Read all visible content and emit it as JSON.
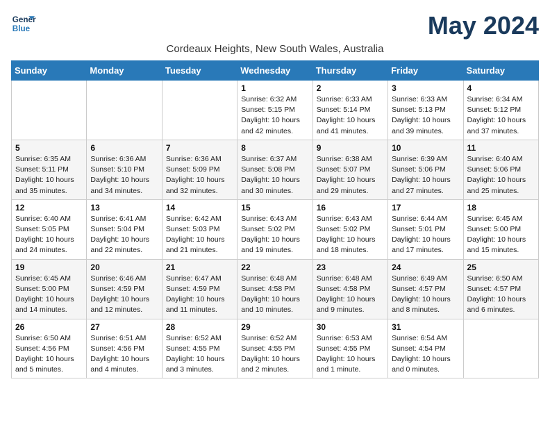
{
  "header": {
    "logo_line1": "General",
    "logo_line2": "Blue",
    "month_title": "May 2024",
    "subtitle": "Cordeaux Heights, New South Wales, Australia"
  },
  "weekdays": [
    "Sunday",
    "Monday",
    "Tuesday",
    "Wednesday",
    "Thursday",
    "Friday",
    "Saturday"
  ],
  "weeks": [
    [
      {
        "day": "",
        "info": ""
      },
      {
        "day": "",
        "info": ""
      },
      {
        "day": "",
        "info": ""
      },
      {
        "day": "1",
        "info": "Sunrise: 6:32 AM\nSunset: 5:15 PM\nDaylight: 10 hours and 42 minutes."
      },
      {
        "day": "2",
        "info": "Sunrise: 6:33 AM\nSunset: 5:14 PM\nDaylight: 10 hours and 41 minutes."
      },
      {
        "day": "3",
        "info": "Sunrise: 6:33 AM\nSunset: 5:13 PM\nDaylight: 10 hours and 39 minutes."
      },
      {
        "day": "4",
        "info": "Sunrise: 6:34 AM\nSunset: 5:12 PM\nDaylight: 10 hours and 37 minutes."
      }
    ],
    [
      {
        "day": "5",
        "info": "Sunrise: 6:35 AM\nSunset: 5:11 PM\nDaylight: 10 hours and 35 minutes."
      },
      {
        "day": "6",
        "info": "Sunrise: 6:36 AM\nSunset: 5:10 PM\nDaylight: 10 hours and 34 minutes."
      },
      {
        "day": "7",
        "info": "Sunrise: 6:36 AM\nSunset: 5:09 PM\nDaylight: 10 hours and 32 minutes."
      },
      {
        "day": "8",
        "info": "Sunrise: 6:37 AM\nSunset: 5:08 PM\nDaylight: 10 hours and 30 minutes."
      },
      {
        "day": "9",
        "info": "Sunrise: 6:38 AM\nSunset: 5:07 PM\nDaylight: 10 hours and 29 minutes."
      },
      {
        "day": "10",
        "info": "Sunrise: 6:39 AM\nSunset: 5:06 PM\nDaylight: 10 hours and 27 minutes."
      },
      {
        "day": "11",
        "info": "Sunrise: 6:40 AM\nSunset: 5:06 PM\nDaylight: 10 hours and 25 minutes."
      }
    ],
    [
      {
        "day": "12",
        "info": "Sunrise: 6:40 AM\nSunset: 5:05 PM\nDaylight: 10 hours and 24 minutes."
      },
      {
        "day": "13",
        "info": "Sunrise: 6:41 AM\nSunset: 5:04 PM\nDaylight: 10 hours and 22 minutes."
      },
      {
        "day": "14",
        "info": "Sunrise: 6:42 AM\nSunset: 5:03 PM\nDaylight: 10 hours and 21 minutes."
      },
      {
        "day": "15",
        "info": "Sunrise: 6:43 AM\nSunset: 5:02 PM\nDaylight: 10 hours and 19 minutes."
      },
      {
        "day": "16",
        "info": "Sunrise: 6:43 AM\nSunset: 5:02 PM\nDaylight: 10 hours and 18 minutes."
      },
      {
        "day": "17",
        "info": "Sunrise: 6:44 AM\nSunset: 5:01 PM\nDaylight: 10 hours and 17 minutes."
      },
      {
        "day": "18",
        "info": "Sunrise: 6:45 AM\nSunset: 5:00 PM\nDaylight: 10 hours and 15 minutes."
      }
    ],
    [
      {
        "day": "19",
        "info": "Sunrise: 6:45 AM\nSunset: 5:00 PM\nDaylight: 10 hours and 14 minutes."
      },
      {
        "day": "20",
        "info": "Sunrise: 6:46 AM\nSunset: 4:59 PM\nDaylight: 10 hours and 12 minutes."
      },
      {
        "day": "21",
        "info": "Sunrise: 6:47 AM\nSunset: 4:59 PM\nDaylight: 10 hours and 11 minutes."
      },
      {
        "day": "22",
        "info": "Sunrise: 6:48 AM\nSunset: 4:58 PM\nDaylight: 10 hours and 10 minutes."
      },
      {
        "day": "23",
        "info": "Sunrise: 6:48 AM\nSunset: 4:58 PM\nDaylight: 10 hours and 9 minutes."
      },
      {
        "day": "24",
        "info": "Sunrise: 6:49 AM\nSunset: 4:57 PM\nDaylight: 10 hours and 8 minutes."
      },
      {
        "day": "25",
        "info": "Sunrise: 6:50 AM\nSunset: 4:57 PM\nDaylight: 10 hours and 6 minutes."
      }
    ],
    [
      {
        "day": "26",
        "info": "Sunrise: 6:50 AM\nSunset: 4:56 PM\nDaylight: 10 hours and 5 minutes."
      },
      {
        "day": "27",
        "info": "Sunrise: 6:51 AM\nSunset: 4:56 PM\nDaylight: 10 hours and 4 minutes."
      },
      {
        "day": "28",
        "info": "Sunrise: 6:52 AM\nSunset: 4:55 PM\nDaylight: 10 hours and 3 minutes."
      },
      {
        "day": "29",
        "info": "Sunrise: 6:52 AM\nSunset: 4:55 PM\nDaylight: 10 hours and 2 minutes."
      },
      {
        "day": "30",
        "info": "Sunrise: 6:53 AM\nSunset: 4:55 PM\nDaylight: 10 hours and 1 minute."
      },
      {
        "day": "31",
        "info": "Sunrise: 6:54 AM\nSunset: 4:54 PM\nDaylight: 10 hours and 0 minutes."
      },
      {
        "day": "",
        "info": ""
      }
    ]
  ]
}
